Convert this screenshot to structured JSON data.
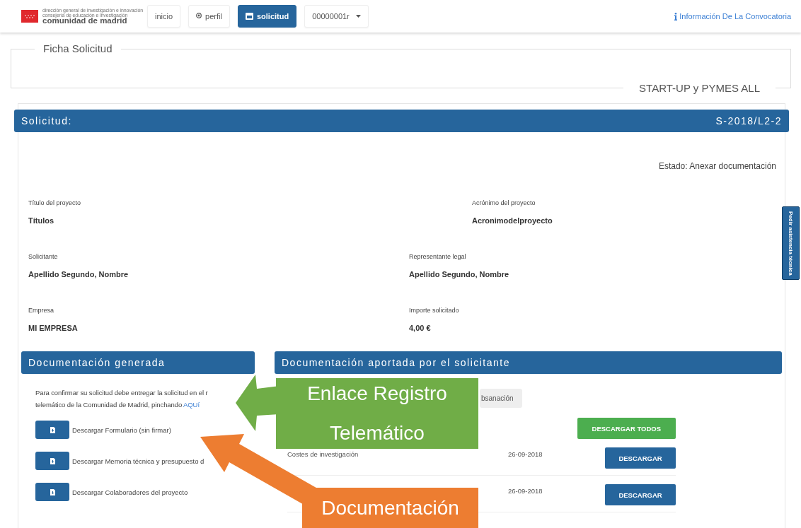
{
  "nav": {
    "logo": {
      "line_1": "dirección general de investigación e innovación",
      "line_2": "consejería de educación e investigación",
      "line_3": "comunidad de madrid"
    },
    "items": [
      {
        "label": "inicio",
        "kind": "plain",
        "selected": false
      },
      {
        "label": "perfil",
        "kind": "user",
        "selected": false
      },
      {
        "label": "solicitud",
        "kind": "card",
        "selected": true
      },
      {
        "label": "00000001r",
        "kind": "dropdown",
        "selected": false
      }
    ],
    "info_link": "Información De La Convocatoria"
  },
  "ficha": {
    "title": "Ficha Solicitud",
    "program": "START-UP y PYMES ALL"
  },
  "solicitud": {
    "title": "Solicitud:",
    "code": "S-2018/L2-2",
    "estado": "Estado: Anexar documentación",
    "field_rows": [
      [
        {
          "label": "Título del proyecto",
          "value": "Títulos"
        },
        {
          "label": "Acrónimo del proyecto",
          "value": "Acronimodelproyecto"
        }
      ],
      [
        {
          "label": "Solicitante",
          "value": "Apellido Segundo, Nombre"
        },
        {
          "label": "Representante legal",
          "value": "Apellido Segundo, Nombre"
        }
      ],
      [
        {
          "label": "Empresa",
          "value": "MI EMPRESA"
        },
        {
          "label": "Importe solicitado",
          "value": "4,00 €"
        }
      ]
    ]
  },
  "help_tab": "Pedir asistencia técnica",
  "generated": {
    "title": "Documentación generada",
    "notice": {
      "line_1": "Para confirmar su solicitud debe entregar la solicitud en el r",
      "line_2": "telemático de la Comunidad de Madrid, pinchando",
      "link": "AQUí"
    },
    "downloads": [
      "Descargar Formulario (sin firmar)",
      "Descargar Memoria técnica y presupuesto d",
      "Descargar Colaboradores del proyecto"
    ]
  },
  "provided": {
    "title": "Documentación aportada por el solicitante",
    "subsanacion_button": "bsanación",
    "download_all": "DESCARGAR TODOS",
    "rows": [
      {
        "name": "Costes de investigación",
        "date": "26-09-2018",
        "button": "DESCARGAR"
      },
      {
        "date": "26-09-2018",
        "button": "DESCARGAR"
      }
    ]
  },
  "callouts": [
    {
      "text": "Enlace Registro Telemático",
      "color": "#70ad47"
    },
    {
      "text": "Documentación",
      "color": "#ed7d31"
    }
  ]
}
